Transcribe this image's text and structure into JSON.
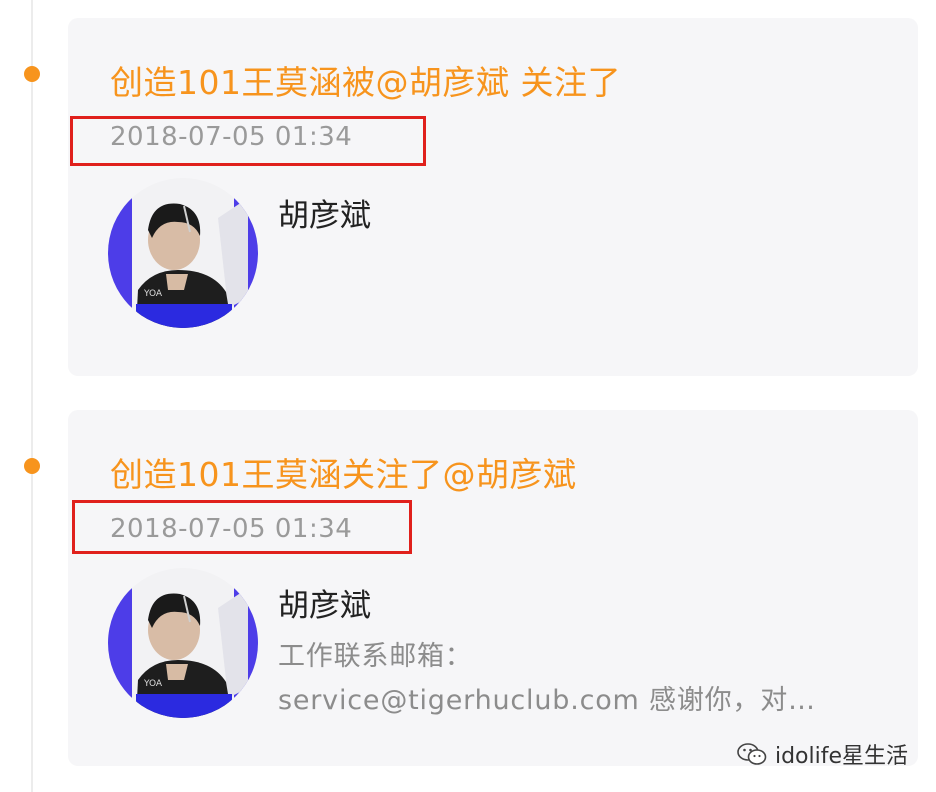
{
  "feed": [
    {
      "title": "创造101王莫涵被@胡彦斌 关注了",
      "timestamp": "2018-07-05 01:34",
      "user": {
        "name": "胡彦斌",
        "bio_line1": "",
        "bio_line2": ""
      }
    },
    {
      "title": "创造101王莫涵关注了@胡彦斌",
      "timestamp": "2018-07-05 01:34",
      "user": {
        "name": "胡彦斌",
        "bio_line1": "工作联系邮箱：",
        "bio_line2": "service@tigerhuclub.com  感谢你，对…"
      }
    }
  ],
  "watermark": {
    "text": "idolife星生活",
    "icon": "wechat-icon"
  },
  "colors": {
    "accent": "#f7941d",
    "highlight": "#e0201c",
    "card_bg": "#f6f6f8",
    "avatar_ring": "#4d3de8"
  }
}
